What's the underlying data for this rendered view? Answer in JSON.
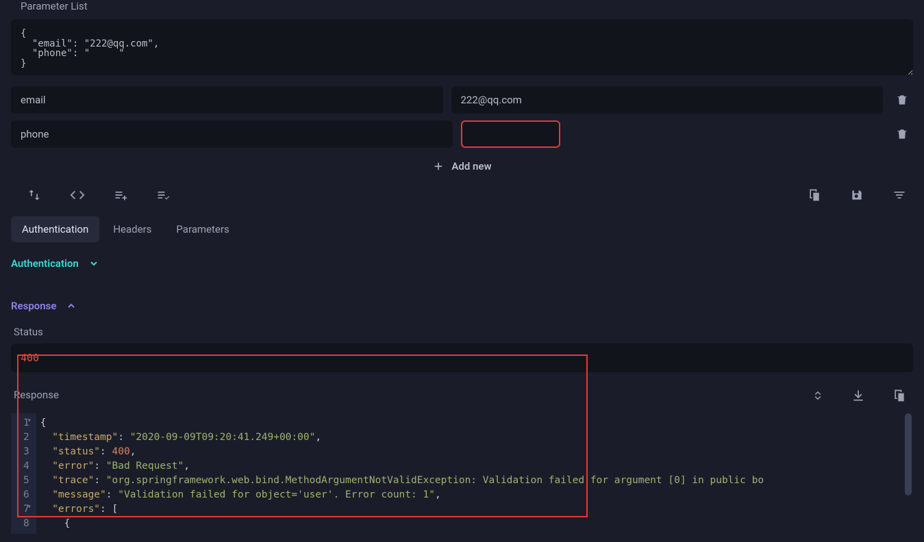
{
  "parameterList": {
    "label": "Parameter List",
    "jsonText": "{\n  \"email\": \"222@qq.com\",\n  \"phone\": \"     \"\n}",
    "rows": [
      {
        "key": "email",
        "value": "222@qq.com"
      },
      {
        "key": "phone",
        "value": ""
      }
    ],
    "addNewLabel": "Add new"
  },
  "tabs": {
    "authentication": "Authentication",
    "headers": "Headers",
    "parameters": "Parameters"
  },
  "sections": {
    "authenticationTitle": "Authentication",
    "responseTitle": "Response"
  },
  "status": {
    "label": "Status",
    "value": "400"
  },
  "responseBody": {
    "label": "Response",
    "lines": [
      {
        "n": "1",
        "raw": "{"
      },
      {
        "n": "2",
        "key": "timestamp",
        "str": "2020-09-09T09:20:41.249+00:00",
        "comma": true
      },
      {
        "n": "3",
        "key": "status",
        "num": "400",
        "comma": true
      },
      {
        "n": "4",
        "key": "error",
        "str": "Bad Request",
        "comma": true
      },
      {
        "n": "5",
        "key": "trace",
        "str": "org.springframework.web.bind.MethodArgumentNotValidException: Validation failed for argument [0] in public bo",
        "truncated": true
      },
      {
        "n": "6",
        "key": "message",
        "str": "Validation failed for object='user'. Error count: 1",
        "comma": true
      },
      {
        "n": "7",
        "key": "errors",
        "open": "["
      },
      {
        "n": "8",
        "raw": "    {"
      }
    ]
  }
}
